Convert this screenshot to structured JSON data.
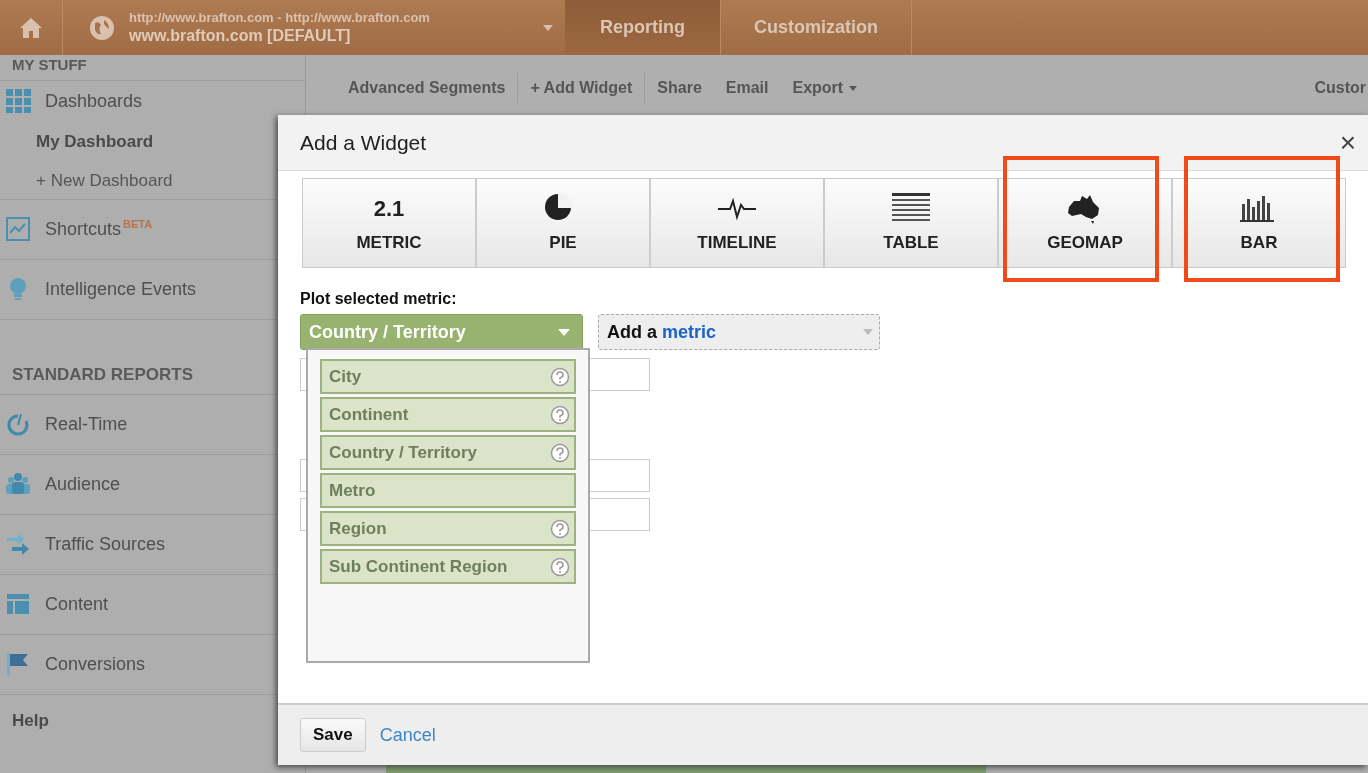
{
  "top_bar": {
    "property_url": "http://www.brafton.com - http://www.brafton.com",
    "property_name": "www.brafton.com [DEFAULT]",
    "tabs": [
      {
        "label": "Reporting",
        "selected": true
      },
      {
        "label": "Customization",
        "selected": false
      }
    ]
  },
  "sidebar": {
    "items": [
      {
        "kind": "header",
        "label": "MY STUFF"
      },
      {
        "kind": "item",
        "label": "Dashboards"
      },
      {
        "kind": "sub",
        "label": "My Dashboard",
        "selected": true
      },
      {
        "kind": "sub",
        "label": "+ New Dashboard",
        "selected": false
      },
      {
        "kind": "item",
        "label": "Shortcuts",
        "badge": "BETA"
      },
      {
        "kind": "item",
        "label": "Intelligence Events"
      },
      {
        "kind": "section",
        "label": "STANDARD REPORTS"
      },
      {
        "kind": "item",
        "label": "Real-Time"
      },
      {
        "kind": "item",
        "label": "Audience"
      },
      {
        "kind": "item",
        "label": "Traffic Sources"
      },
      {
        "kind": "item",
        "label": "Content"
      },
      {
        "kind": "item",
        "label": "Conversions"
      },
      {
        "kind": "footer",
        "label": "Help"
      }
    ]
  },
  "toolbar": {
    "items": [
      {
        "label": "Advanced Segments",
        "dropdown": false
      },
      {
        "label": "+ Add Widget",
        "dropdown": false
      },
      {
        "label": "Share",
        "dropdown": false
      },
      {
        "label": "Email",
        "dropdown": false
      },
      {
        "label": "Export",
        "dropdown": true
      }
    ],
    "right_label": "Custor"
  },
  "dialog": {
    "title": "Add a Widget",
    "close": "×",
    "widget_types": [
      {
        "glyph": "2.1",
        "label": "METRIC",
        "highlighted": false
      },
      {
        "label": "PIE",
        "highlighted": false
      },
      {
        "label": "TIMELINE",
        "highlighted": false
      },
      {
        "label": "TABLE",
        "highlighted": false
      },
      {
        "label": "GEOMAP",
        "highlighted": true
      },
      {
        "label": "BAR",
        "highlighted": true
      }
    ],
    "metric_label": "Plot selected metric:",
    "metric_value": "Country / Territory",
    "add_metric": {
      "prefix": "Add a",
      "link": "metric"
    },
    "options": [
      {
        "label": "City",
        "help": true
      },
      {
        "label": "Continent",
        "help": true
      },
      {
        "label": "Country / Territory",
        "help": true
      },
      {
        "label": "Metro",
        "help": false
      },
      {
        "label": "Region",
        "help": true
      },
      {
        "label": "Sub Continent Region",
        "help": true
      }
    ],
    "save": "Save",
    "cancel": "Cancel"
  }
}
